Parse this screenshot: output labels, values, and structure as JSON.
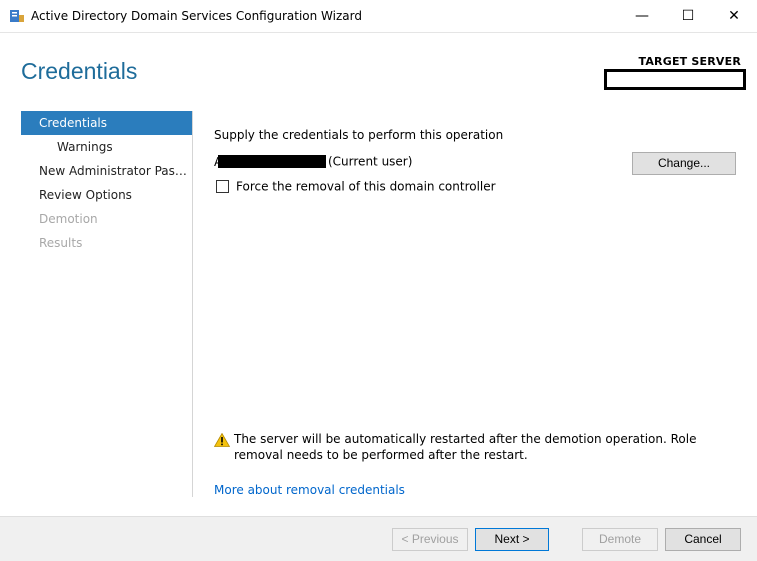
{
  "window": {
    "title": "Active Directory Domain Services Configuration Wizard",
    "minimize_glyph": "—",
    "maximize_glyph": "☐",
    "close_glyph": "✕"
  },
  "header": {
    "page_title": "Credentials",
    "target_label": "TARGET SERVER",
    "target_value": ""
  },
  "nav": {
    "items": [
      {
        "label": "Credentials"
      },
      {
        "label": "Warnings"
      },
      {
        "label": "New Administrator Password"
      },
      {
        "label": "Review Options"
      },
      {
        "label": "Demotion"
      },
      {
        "label": "Results"
      }
    ]
  },
  "main": {
    "supply_text": "Supply the credentials to perform this operation",
    "user_prefix": "A",
    "current_user_text": "(Current user)",
    "change_label": "Change...",
    "force_label": "Force the removal of this domain controller",
    "force_checked": false,
    "warning_text": "The server will be automatically restarted after the demotion operation. Role removal needs to be performed after the restart.",
    "more_link": "More about removal credentials"
  },
  "footer": {
    "previous": "< Previous",
    "next": "Next >",
    "demote": "Demote",
    "cancel": "Cancel"
  },
  "colors": {
    "accent": "#2b7dbd",
    "title_blue": "#1e6c9a",
    "link": "#0066cc",
    "warning": "#f4c20d"
  },
  "icons": {
    "app": "server-manager-icon",
    "warning": "warning-triangle-icon"
  }
}
